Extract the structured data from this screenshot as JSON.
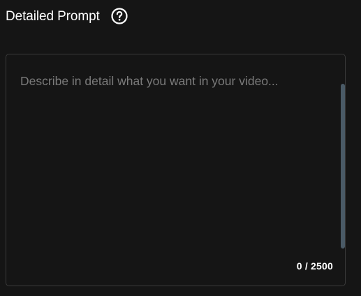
{
  "header": {
    "title": "Detailed Prompt",
    "help_icon": "question-circle-icon"
  },
  "prompt": {
    "placeholder": "Describe in detail what you want in your video...",
    "value": "",
    "counter": "0 / 2500",
    "scroll_position_fraction": 0
  },
  "colors": {
    "background": "#151515",
    "border": "#3a3a3a",
    "placeholder": "#7b7b7b",
    "scrollbar": "#4a5a66",
    "text": "#ffffff"
  }
}
